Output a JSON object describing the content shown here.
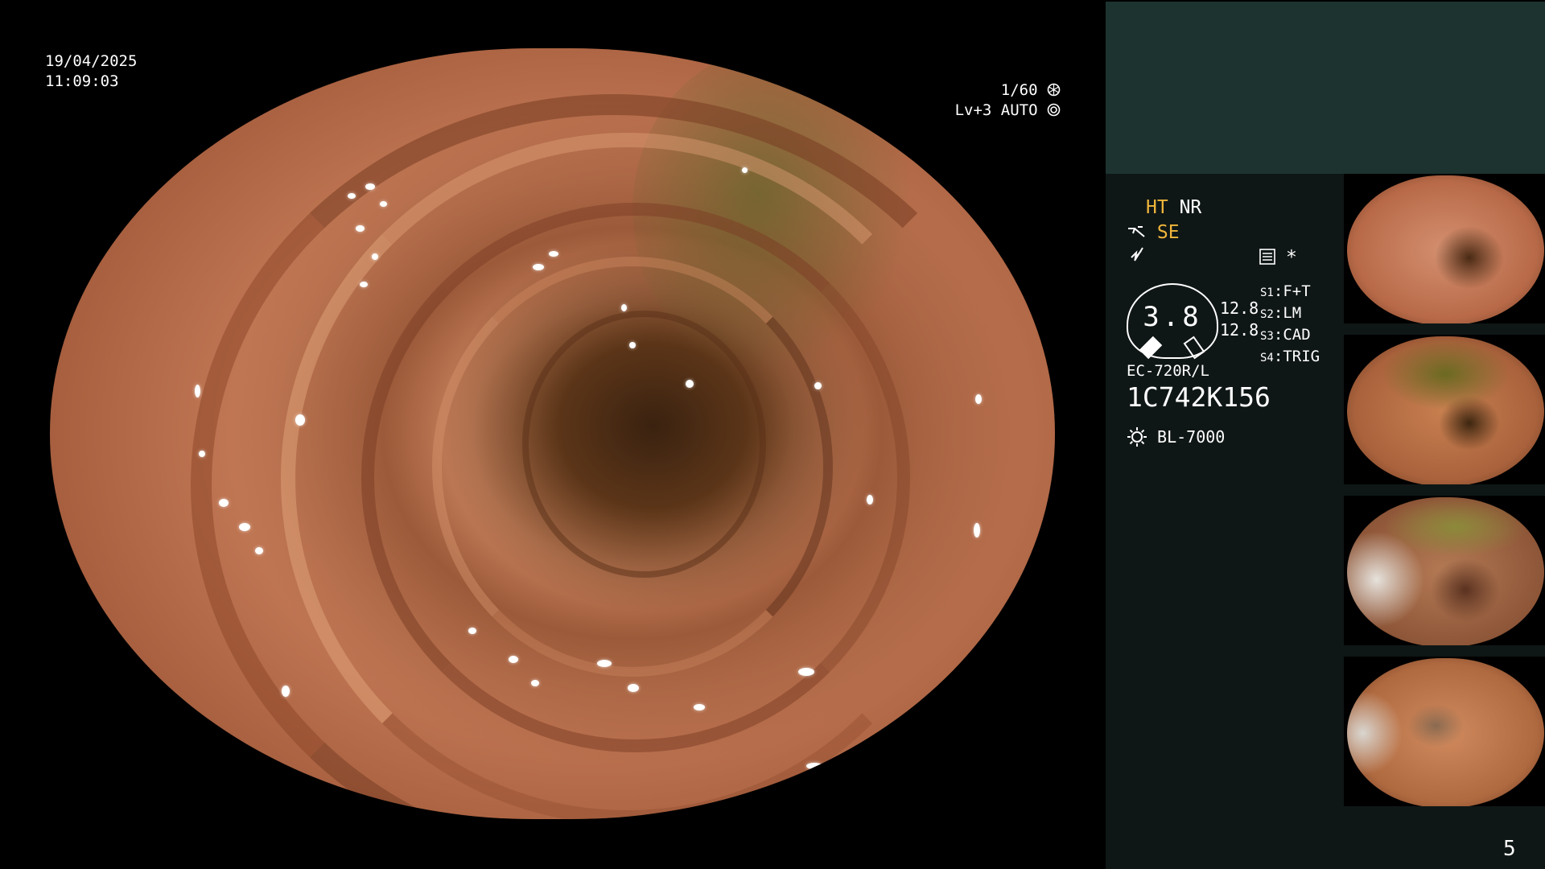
{
  "overlay": {
    "date": "19/04/2025",
    "time": "11:09:03",
    "shutter": "1/60",
    "level": "Lv+3",
    "iris": "AUTO"
  },
  "panel": {
    "ht": "HT",
    "nr": "NR",
    "se": "SE",
    "gauge_value": "3.8",
    "gauge_right_top": "12.8",
    "gauge_right_bottom": "12.8",
    "switches": [
      {
        "key": "S1",
        "value": "F+T"
      },
      {
        "key": "S2",
        "value": "LM"
      },
      {
        "key": "S3",
        "value": "CAD"
      },
      {
        "key": "S4",
        "value": "TRIG"
      }
    ],
    "scope_model": "EC-720R/L",
    "scope_serial": "1C742K156",
    "light_source": "BL-7000",
    "asterisk": "*",
    "page_number": "5"
  },
  "colors": {
    "accent": "#f0b63c",
    "panel_top": "#1d3330",
    "panel_body": "#0f1716"
  },
  "icons": [
    "shutter-icon",
    "iris-icon",
    "scope-tip-icon",
    "flash-icon",
    "memory-icon",
    "light-source-icon"
  ]
}
